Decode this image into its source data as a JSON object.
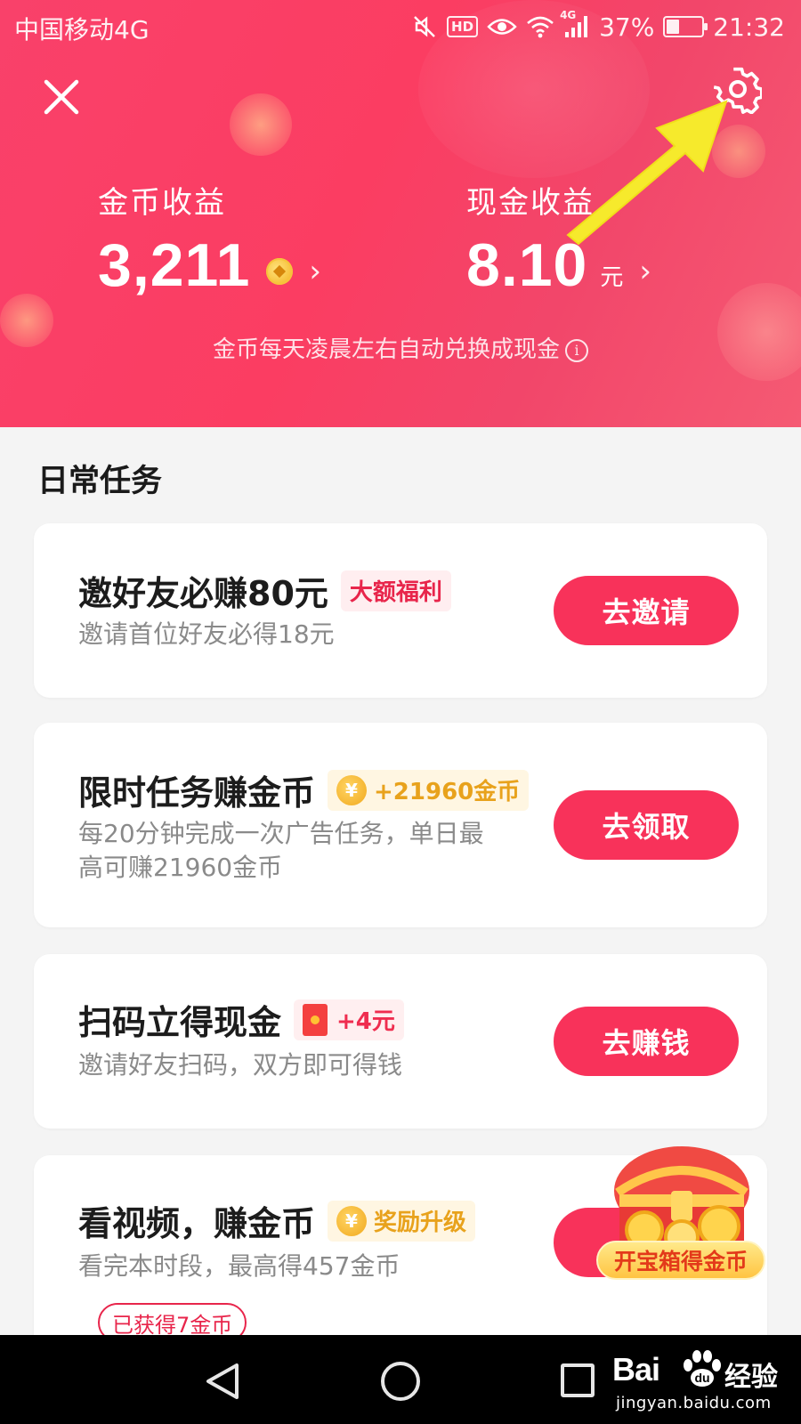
{
  "status_bar": {
    "carrier": "中国移动4G",
    "hd": "HD",
    "network": "4G",
    "battery": "37%",
    "battery_level": 0.37,
    "time": "21:32"
  },
  "header": {
    "coin_label": "金币收益",
    "coin_value": "3,211",
    "cash_label": "现金收益",
    "cash_value": "8.10",
    "cash_unit": "元",
    "notice": "金币每天凌晨左右自动兑换成现金",
    "accent_color": "#fb3d62",
    "icons": [
      "close-icon",
      "gear-icon",
      "coin-icon",
      "chevron-right-icon",
      "info-icon",
      "yellow-arrow"
    ]
  },
  "section": {
    "title": "日常任务"
  },
  "tasks": [
    {
      "title": "邀好友必赚80元",
      "tag": "大额福利",
      "desc": "邀请首位好友必得18元",
      "button": "去邀请"
    },
    {
      "title": "限时任务赚金币",
      "tag": "+21960金币",
      "desc_line1": "每20分钟完成一次广告任务，单日最",
      "desc_line2": "高可赚21960金币",
      "button": "去领取"
    },
    {
      "title": "扫码立得现金",
      "tag": "+4元",
      "desc": "邀请好友扫码，双方即可得钱",
      "button": "去赚钱"
    },
    {
      "title": "看视频，赚金币",
      "tag": "奖励升级",
      "desc": "看完本时段，最高得457金币",
      "earned": "已获得7金币"
    }
  ],
  "treasure": {
    "label": "开宝箱得金币"
  },
  "watermark": {
    "brand": "Bai",
    "brand2": "du",
    "product": "经验",
    "url": "jingyan.baidu.com"
  },
  "colors": {
    "button": "#f8325a",
    "gold": "#e8a21c",
    "tag_red": "#e8254b"
  }
}
